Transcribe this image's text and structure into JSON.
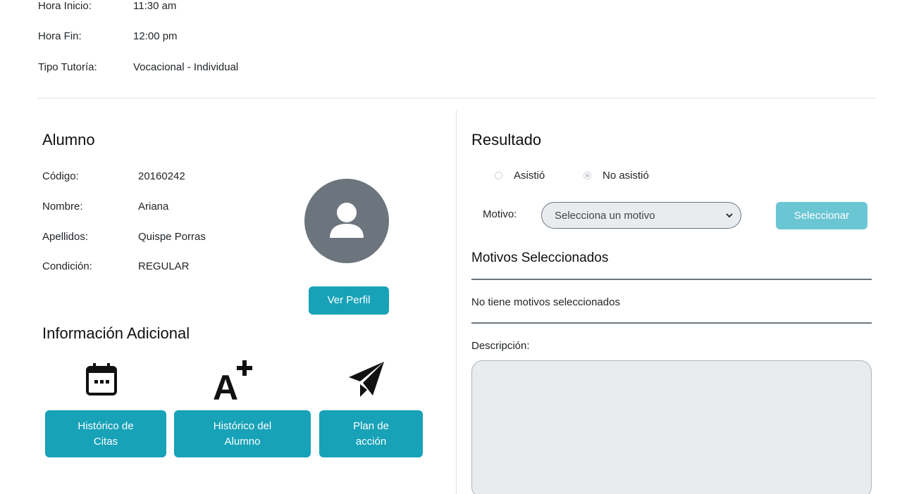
{
  "header_info": {
    "hora_inicio_label": "Hora Inicio:",
    "hora_inicio_value": "11:30 am",
    "hora_fin_label": "Hora Fin:",
    "hora_fin_value": "12:00 pm",
    "tipo_label": "Tipo Tutoría:",
    "tipo_value": "Vocacional - Individual"
  },
  "alumno": {
    "title": "Alumno",
    "codigo_label": "Código:",
    "codigo_value": "20160242",
    "nombre_label": "Nombre:",
    "nombre_value": "Ariana",
    "apellidos_label": "Apellidos:",
    "apellidos_value": "Quispe Porras",
    "condicion_label": "Condición:",
    "condicion_value": "REGULAR",
    "ver_perfil_label": "Ver Perfil"
  },
  "info_adicional": {
    "title": "Información Adicional",
    "buttons": [
      {
        "label_line1": "Histórico de",
        "label_line2": "Citas",
        "icon": "calendar-icon"
      },
      {
        "label_line1": "Histórico del",
        "label_line2": "Alumno",
        "icon": "font-increase-icon"
      },
      {
        "label_line1": "Plan de",
        "label_line2": "acción",
        "icon": "paper-plane-icon"
      }
    ]
  },
  "resultado": {
    "title": "Resultado",
    "radio_asistio": "Asistió",
    "radio_no_asistio": "No asistió",
    "selected_radio": "No asistió",
    "motivo_label": "Motivo:",
    "motivo_select_value": "Selecciona un motivo",
    "seleccionar_label": "Seleccionar",
    "motivos_title": "Motivos Seleccionados",
    "no_motivos_text": "No tiene motivos seleccionados",
    "descripcion_label": "Descripción:",
    "descripcion_value": ""
  },
  "colors": {
    "accent": "#17a2b8",
    "accent_disabled": "#6ac6d3",
    "avatar_bg": "#6c757d"
  }
}
